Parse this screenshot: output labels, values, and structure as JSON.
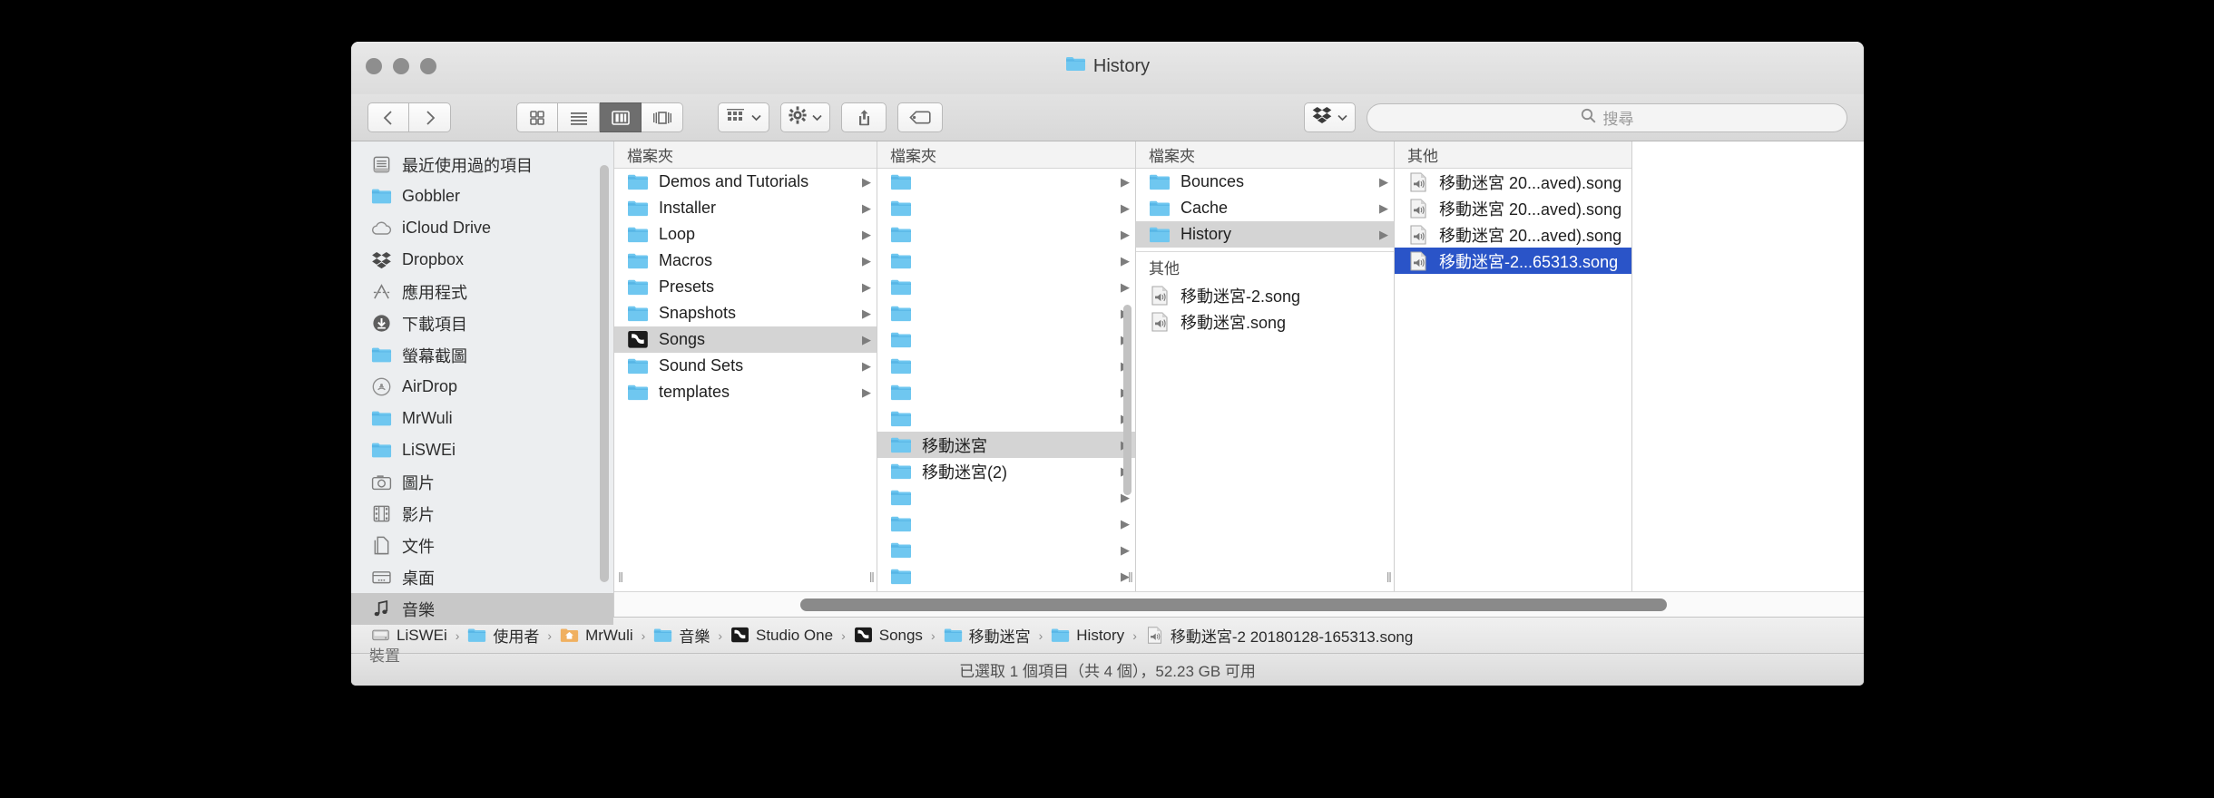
{
  "window": {
    "title": "History",
    "title_icon": "folder-icon",
    "traffic_lights": [
      "close-button",
      "minimize-button",
      "zoom-button"
    ]
  },
  "toolbar": {
    "back_label": "‹",
    "forward_label": "›",
    "view_modes": [
      {
        "name": "icon-view",
        "selected": false
      },
      {
        "name": "list-view",
        "selected": false
      },
      {
        "name": "column-view",
        "selected": true
      },
      {
        "name": "coverflow-view",
        "selected": false
      }
    ],
    "arrange_icon": "arrange-icon",
    "action_icon": "gear-icon",
    "share_icon": "share-icon",
    "tag_icon": "tag-icon",
    "dropbox_icon": "dropbox-icon",
    "chevron": "˅"
  },
  "search": {
    "icon": "search-icon",
    "placeholder": "搜尋",
    "value": ""
  },
  "sidebar": {
    "items": [
      {
        "label": "最近使用過的項目",
        "icon": "recents-icon",
        "selected": false
      },
      {
        "label": "Gobbler",
        "icon": "folder-icon",
        "selected": false
      },
      {
        "label": "iCloud Drive",
        "icon": "cloud-icon",
        "selected": false
      },
      {
        "label": "Dropbox",
        "icon": "dropbox-icon",
        "selected": false
      },
      {
        "label": "應用程式",
        "icon": "applications-icon",
        "selected": false
      },
      {
        "label": "下載項目",
        "icon": "downloads-icon",
        "selected": false
      },
      {
        "label": "螢幕截圖",
        "icon": "folder-icon",
        "selected": false
      },
      {
        "label": "AirDrop",
        "icon": "airdrop-icon",
        "selected": false
      },
      {
        "label": "MrWuli",
        "icon": "folder-icon",
        "selected": false
      },
      {
        "label": "LiSWEi",
        "icon": "folder-icon",
        "selected": false
      },
      {
        "label": "圖片",
        "icon": "pictures-icon",
        "selected": false
      },
      {
        "label": "影片",
        "icon": "movies-icon",
        "selected": false
      },
      {
        "label": "文件",
        "icon": "documents-icon",
        "selected": false
      },
      {
        "label": "桌面",
        "icon": "desktop-icon",
        "selected": false
      },
      {
        "label": "音樂",
        "icon": "music-icon",
        "selected": true
      }
    ],
    "devices_header": "裝置"
  },
  "columns": [
    {
      "header": "檔案夾",
      "items": [
        {
          "name": "Demos and Tutorials",
          "icon": "folder-icon",
          "selected": false,
          "arrow": true
        },
        {
          "name": "Installer",
          "icon": "folder-icon",
          "selected": false,
          "arrow": true
        },
        {
          "name": "Loop",
          "icon": "folder-icon",
          "selected": false,
          "arrow": true
        },
        {
          "name": "Macros",
          "icon": "folder-icon",
          "selected": false,
          "arrow": true
        },
        {
          "name": "Presets",
          "icon": "folder-icon",
          "selected": false,
          "arrow": true
        },
        {
          "name": "Snapshots",
          "icon": "folder-icon",
          "selected": false,
          "arrow": true
        },
        {
          "name": "Songs",
          "icon": "studio-one-folder-icon",
          "selected": true,
          "arrow": true
        },
        {
          "name": "Sound Sets",
          "icon": "folder-icon",
          "selected": false,
          "arrow": true
        },
        {
          "name": "templates",
          "icon": "folder-icon",
          "selected": false,
          "arrow": true
        }
      ]
    },
    {
      "header": "檔案夾",
      "items": [
        {
          "name": "",
          "icon": "folder-icon",
          "selected": false,
          "arrow": true
        },
        {
          "name": "",
          "icon": "folder-icon",
          "selected": false,
          "arrow": true
        },
        {
          "name": "",
          "icon": "folder-icon",
          "selected": false,
          "arrow": true
        },
        {
          "name": "",
          "icon": "folder-icon",
          "selected": false,
          "arrow": true
        },
        {
          "name": "",
          "icon": "folder-icon",
          "selected": false,
          "arrow": true
        },
        {
          "name": "",
          "icon": "folder-icon",
          "selected": false,
          "arrow": true
        },
        {
          "name": "",
          "icon": "folder-icon",
          "selected": false,
          "arrow": true
        },
        {
          "name": "",
          "icon": "folder-icon",
          "selected": false,
          "arrow": true
        },
        {
          "name": "",
          "icon": "folder-icon",
          "selected": false,
          "arrow": true
        },
        {
          "name": "",
          "icon": "folder-icon",
          "selected": false,
          "arrow": true
        },
        {
          "name": "移動迷宮",
          "icon": "folder-icon",
          "selected": true,
          "arrow": true
        },
        {
          "name": "移動迷宮(2)",
          "icon": "folder-icon",
          "selected": false,
          "arrow": true
        },
        {
          "name": "",
          "icon": "folder-icon",
          "selected": false,
          "arrow": true
        },
        {
          "name": "",
          "icon": "folder-icon",
          "selected": false,
          "arrow": true
        },
        {
          "name": "",
          "icon": "folder-icon",
          "selected": false,
          "arrow": true
        },
        {
          "name": "",
          "icon": "folder-icon",
          "selected": false,
          "arrow": true
        }
      ]
    },
    {
      "header": "檔案夾",
      "items": [
        {
          "name": "Bounces",
          "icon": "folder-icon",
          "selected": false,
          "arrow": true
        },
        {
          "name": "Cache",
          "icon": "folder-icon",
          "selected": false,
          "arrow": true
        },
        {
          "name": "History",
          "icon": "folder-icon",
          "selected": true,
          "arrow": true
        }
      ],
      "subheader": "其他",
      "sub_items": [
        {
          "name": "移動迷宮-2.song",
          "icon": "song-file-icon",
          "selected": false,
          "arrow": false
        },
        {
          "name": "移動迷宮.song",
          "icon": "song-file-icon",
          "selected": false,
          "arrow": false
        }
      ]
    },
    {
      "header": "其他",
      "items": [
        {
          "name": "移動迷宮 20...aved).song",
          "icon": "song-file-icon",
          "selected": false,
          "arrow": false
        },
        {
          "name": "移動迷宮 20...aved).song",
          "icon": "song-file-icon",
          "selected": false,
          "arrow": false
        },
        {
          "name": "移動迷宮 20...aved).song",
          "icon": "song-file-icon",
          "selected": false,
          "arrow": false
        },
        {
          "name": "移動迷宮-2...65313.song",
          "icon": "song-file-icon",
          "selected": true,
          "arrow": false
        }
      ]
    }
  ],
  "pathbar": {
    "crumbs": [
      {
        "label": "LiSWEi",
        "icon": "hard-drive-icon"
      },
      {
        "label": "使用者",
        "icon": "users-folder-icon"
      },
      {
        "label": "MrWuli",
        "icon": "home-folder-icon"
      },
      {
        "label": "音樂",
        "icon": "music-folder-icon"
      },
      {
        "label": "Studio One",
        "icon": "studio-one-folder-icon"
      },
      {
        "label": "Songs",
        "icon": "studio-one-folder-icon"
      },
      {
        "label": "移動迷宮",
        "icon": "folder-icon"
      },
      {
        "label": "History",
        "icon": "folder-icon"
      },
      {
        "label": "移動迷宮-2 20180128-165313.song",
        "icon": "song-file-icon"
      }
    ],
    "separator": "›"
  },
  "statusbar": {
    "text": "已選取 1 個項目（共 4 個），52.23 GB 可用"
  },
  "colors": {
    "selection_blue": "#2a54c8",
    "selection_gray": "#d4d4d4",
    "folder_blue": "#6fc7f0",
    "window_chrome": "#e6e6e6"
  }
}
